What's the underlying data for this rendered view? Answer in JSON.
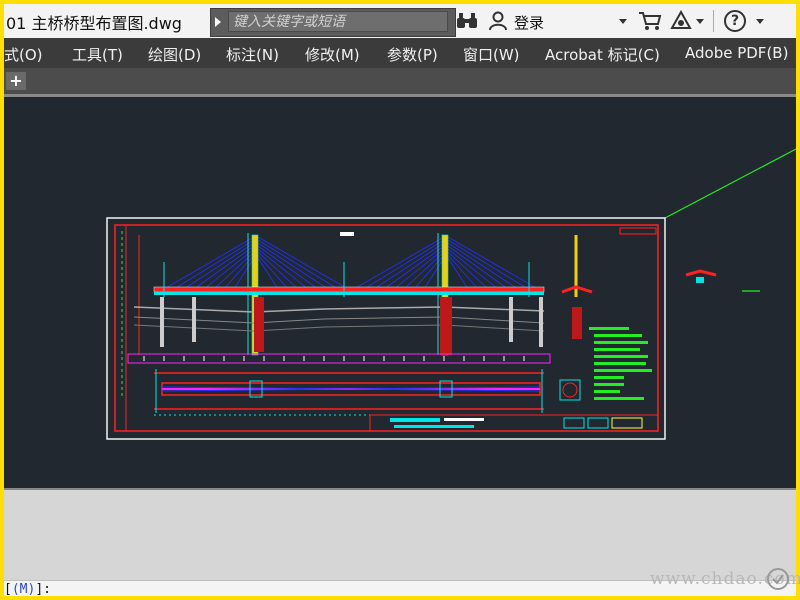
{
  "titlebar": {
    "doc_title": "01 主桥桥型布置图.dwg",
    "search_placeholder": "键入关键字或短语",
    "login_label": "登录",
    "help_label": "?"
  },
  "menu": {
    "items": [
      {
        "label": "式(O)"
      },
      {
        "label": "工具(T)"
      },
      {
        "label": "绘图(D)"
      },
      {
        "label": "标注(N)"
      },
      {
        "label": "修改(M)"
      },
      {
        "label": "参数(P)"
      },
      {
        "label": "窗口(W)"
      },
      {
        "label": "Acrobat 标记(C)"
      },
      {
        "label": "Adobe PDF(B)"
      }
    ]
  },
  "tabs": {
    "add_label": "+"
  },
  "command_line": {
    "prefix": "[",
    "option": "(M)",
    "suffix": "]:"
  },
  "watermark": {
    "text": "www.chdao.com"
  },
  "icons": [
    "search-arrow-icon",
    "binoculars-icon",
    "user-icon",
    "cart-icon",
    "exchange-icon",
    "help-icon",
    "plus-icon"
  ],
  "colors": {
    "canvas_bg": "#212830",
    "frame_border": "#f2f2f2",
    "red": "#ff2020",
    "blue": "#2233ff",
    "cyan": "#00e6e6",
    "green": "#22ee22",
    "magenta": "#ff22ff",
    "yellow": "#ffff33",
    "highlight": "#ffde00"
  }
}
